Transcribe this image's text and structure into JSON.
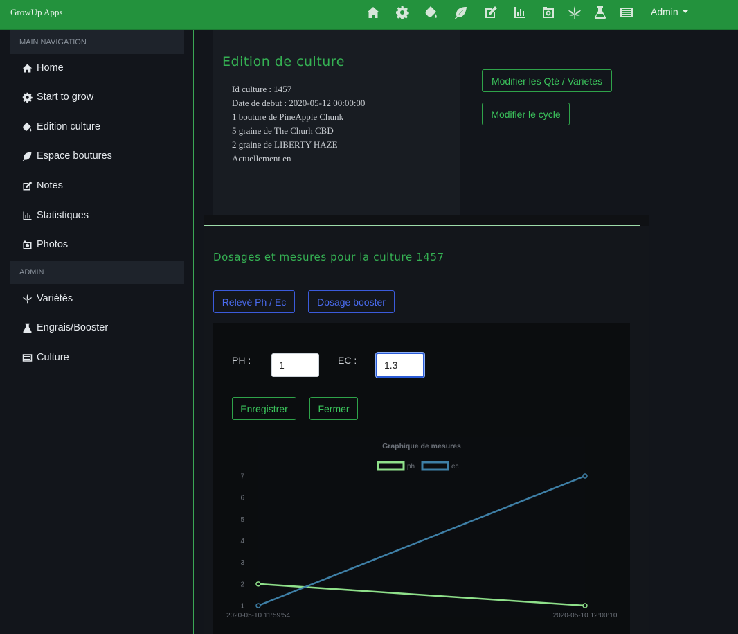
{
  "app": {
    "brand": "GrowUp Apps",
    "user_menu": "Admin"
  },
  "topnav": {
    "icons": [
      "home-icon",
      "gear-icon",
      "paint-bucket-icon",
      "leaf-icon",
      "edit-icon",
      "chart-bar-icon",
      "camera-icon",
      "cannabis-leaf-icon",
      "flask-icon",
      "list-alt-icon"
    ]
  },
  "sidebar": {
    "header_main": "MAIN NAVIGATION",
    "header_admin": "ADMIN",
    "items": [
      {
        "label": "Home",
        "icon": "home-icon"
      },
      {
        "label": "Start to grow",
        "icon": "gear-icon"
      },
      {
        "label": "Edition culture",
        "icon": "paint-bucket-icon"
      },
      {
        "label": "Espace boutures",
        "icon": "leaf-icon"
      },
      {
        "label": "Notes",
        "icon": "edit-icon"
      },
      {
        "label": "Statistiques",
        "icon": "chart-bar-icon"
      },
      {
        "label": "Photos",
        "icon": "camera-icon"
      }
    ],
    "admin_items": [
      {
        "label": "Variétés",
        "icon": "cannabis-leaf-icon"
      },
      {
        "label": "Engrais/Booster",
        "icon": "flask-icon"
      },
      {
        "label": "Culture",
        "icon": "list-alt-icon"
      }
    ]
  },
  "edition": {
    "title": "Edition de culture",
    "info": [
      "Id culture : 1457",
      "Date de debut : 2020-05-12 00:00:00",
      "1 bouture de PineApple Chunk",
      "5 graine de The Churh CBD",
      "2 graine de LIBERTY HAZE",
      "Actuellement en"
    ],
    "btn_modify_qty": "Modifier les Qté / Varietes",
    "btn_modify_cycle": "Modifier le cycle"
  },
  "dosage": {
    "title": "Dosages et mesures pour la culture 1457",
    "btn_releve": "Relevé Ph / Ec",
    "btn_booster": "Dosage booster",
    "ph_label": "PH :",
    "ph_value": "1",
    "ec_label": "EC :",
    "ec_value": "1.3",
    "btn_save": "Enregistrer",
    "btn_close": "Fermer"
  },
  "colors": {
    "accent": "#35b153",
    "topbar": "#23923d",
    "blue": "#4a6cf0",
    "ph_series": "#8fe08a",
    "ec_series": "#3e7fa6"
  },
  "chart_data": {
    "type": "line",
    "title": "Graphique de mesures",
    "x": [
      "2020-05-10 11:59:54",
      "2020-05-10 12:00:10"
    ],
    "series": [
      {
        "name": "ph",
        "values": [
          2,
          1
        ]
      },
      {
        "name": "ec",
        "values": [
          1,
          7
        ]
      }
    ],
    "ylim": [
      1,
      7
    ],
    "yticks": [
      1,
      2,
      3,
      4,
      5,
      6,
      7
    ],
    "legend": "top"
  }
}
